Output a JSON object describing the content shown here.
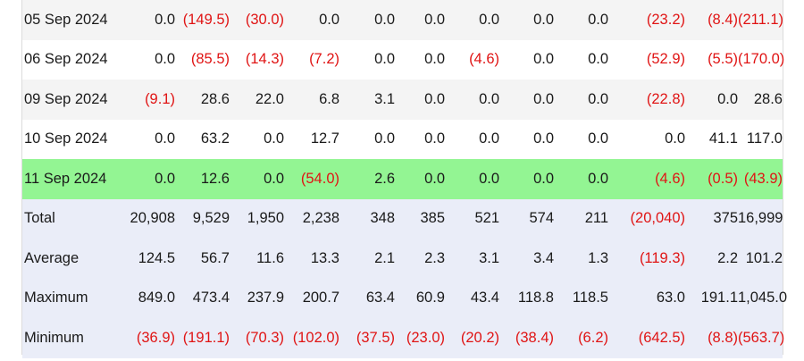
{
  "table": {
    "rows": [
      {
        "label": "05 Sep 2024",
        "style": "odd",
        "cells": [
          "0.0",
          "(149.5)",
          "(30.0)",
          "0.0",
          "0.0",
          "0.0",
          "0.0",
          "0.0",
          "0.0",
          "(23.2)",
          "(8.4)",
          "(211.1)"
        ]
      },
      {
        "label": "06 Sep 2024",
        "style": "even",
        "cells": [
          "0.0",
          "(85.5)",
          "(14.3)",
          "(7.2)",
          "0.0",
          "0.0",
          "(4.6)",
          "0.0",
          "0.0",
          "(52.9)",
          "(5.5)",
          "(170.0)"
        ]
      },
      {
        "label": "09 Sep 2024",
        "style": "odd",
        "cells": [
          "(9.1)",
          "28.6",
          "22.0",
          "6.8",
          "3.1",
          "0.0",
          "0.0",
          "0.0",
          "0.0",
          "(22.8)",
          "0.0",
          "28.6"
        ]
      },
      {
        "label": "10 Sep 2024",
        "style": "even",
        "cells": [
          "0.0",
          "63.2",
          "0.0",
          "12.7",
          "0.0",
          "0.0",
          "0.0",
          "0.0",
          "0.0",
          "0.0",
          "41.1",
          "117.0"
        ]
      },
      {
        "label": "11 Sep 2024",
        "style": "hl",
        "cells": [
          "0.0",
          "12.6",
          "0.0",
          "(54.0)",
          "2.6",
          "0.0",
          "0.0",
          "0.0",
          "0.0",
          "(4.6)",
          "(0.5)",
          "(43.9)"
        ]
      },
      {
        "label": "Total",
        "style": "sum",
        "cells": [
          "20,908",
          "9,529",
          "1,950",
          "2,238",
          "348",
          "385",
          "521",
          "574",
          "211",
          "(20,040)",
          "375",
          "16,999"
        ]
      },
      {
        "label": "Average",
        "style": "sum",
        "cells": [
          "124.5",
          "56.7",
          "11.6",
          "13.3",
          "2.1",
          "2.3",
          "3.1",
          "3.4",
          "1.3",
          "(119.3)",
          "2.2",
          "101.2"
        ]
      },
      {
        "label": "Maximum",
        "style": "sum",
        "cells": [
          "849.0",
          "473.4",
          "237.9",
          "200.7",
          "63.4",
          "60.9",
          "43.4",
          "118.8",
          "118.5",
          "63.0",
          "191.1",
          "1,045.0"
        ]
      },
      {
        "label": "Minimum",
        "style": "sum",
        "cells": [
          "(36.9)",
          "(191.1)",
          "(70.3)",
          "(102.0)",
          "(37.5)",
          "(23.0)",
          "(20.2)",
          "(38.4)",
          "(6.2)",
          "(642.5)",
          "(8.8)",
          "(563.7)"
        ]
      }
    ]
  },
  "colors": {
    "negative": "#e01414",
    "highlight_row": "#93f593",
    "summary_row": "#eaedf8",
    "stripe_row": "#f4f4f4"
  }
}
